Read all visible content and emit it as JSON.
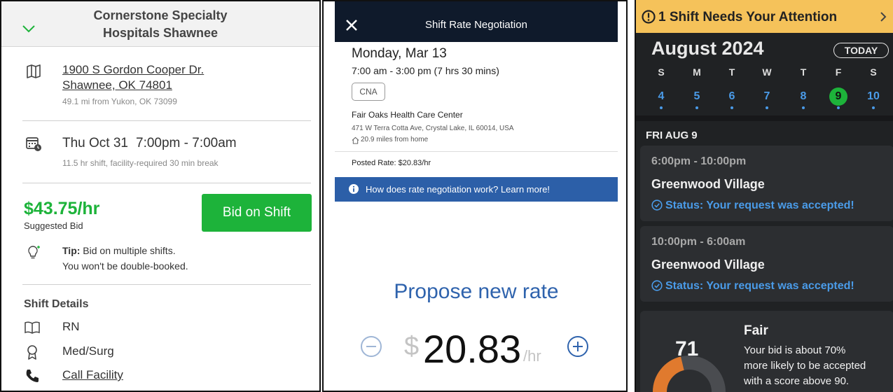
{
  "panel1": {
    "facility_line1": "Cornerstone Specialty",
    "facility_line2": "Hospitals Shawnee",
    "address_line1": "1900 S Gordon Cooper Dr.",
    "address_line2": "Shawnee, OK 74801",
    "distance": "49.1 mi from Yukon, OK 73099",
    "shift_date": "Thu Oct 31",
    "shift_time": "7:00pm - 7:00am",
    "shift_note": "11.5 hr shift, facility-required 30 min break",
    "rate": "$43.75/hr",
    "rate_label": "Suggested Bid",
    "bid_button": "Bid on Shift",
    "tip_label": "Tip:",
    "tip_line1": " Bid on multiple shifts.",
    "tip_line2": "You won't be double-booked.",
    "details_heading": "Shift Details",
    "role": "RN",
    "specialty": "Med/Surg",
    "call_link": "Call Facility",
    "accent": "#1db33a"
  },
  "panel2": {
    "title": "Shift Rate Negotiation",
    "date": "Monday, Mar 13",
    "time": "7:00 am - 3:00 pm (7 hrs 30 mins)",
    "badge": "CNA",
    "facility": "Fair Oaks Health Care Center",
    "address": "471 W Terra Cotta Ave, Crystal Lake, IL 60014, USA",
    "distance": "20.9 miles from home",
    "posted_rate": "Posted Rate: $20.83/hr",
    "info_text": "How does rate negotiation work? Learn more!",
    "propose_label": "Propose new rate",
    "currency": "$",
    "rate_value": "20.83",
    "rate_unit": "/hr",
    "accent": "#2c5fa8"
  },
  "panel3": {
    "alert": "1 Shift Needs Your Attention",
    "month": "August 2024",
    "today_button": "TODAY",
    "weekdays": [
      "S",
      "M",
      "T",
      "W",
      "T",
      "F",
      "S"
    ],
    "days": [
      "4",
      "5",
      "6",
      "7",
      "8",
      "9",
      "10"
    ],
    "selected_day": "9",
    "date_header": "FRI AUG 9",
    "shifts": [
      {
        "time": "6:00pm - 10:00pm",
        "facility": "Greenwood Village",
        "status": "Status: Your request was accepted!"
      },
      {
        "time": "10:00pm - 6:00am",
        "facility": "Greenwood Village",
        "status": "Status: Your request was accepted!"
      }
    ],
    "score": "71",
    "score_fraction": 0.71,
    "score_label": "Fair",
    "score_line1": "Your bid is about 70%",
    "score_line2": "more likely to be accepted",
    "score_line3": "with a score above 90.",
    "accent_blue": "#4a9be8",
    "alert_color": "#f5c25a"
  }
}
